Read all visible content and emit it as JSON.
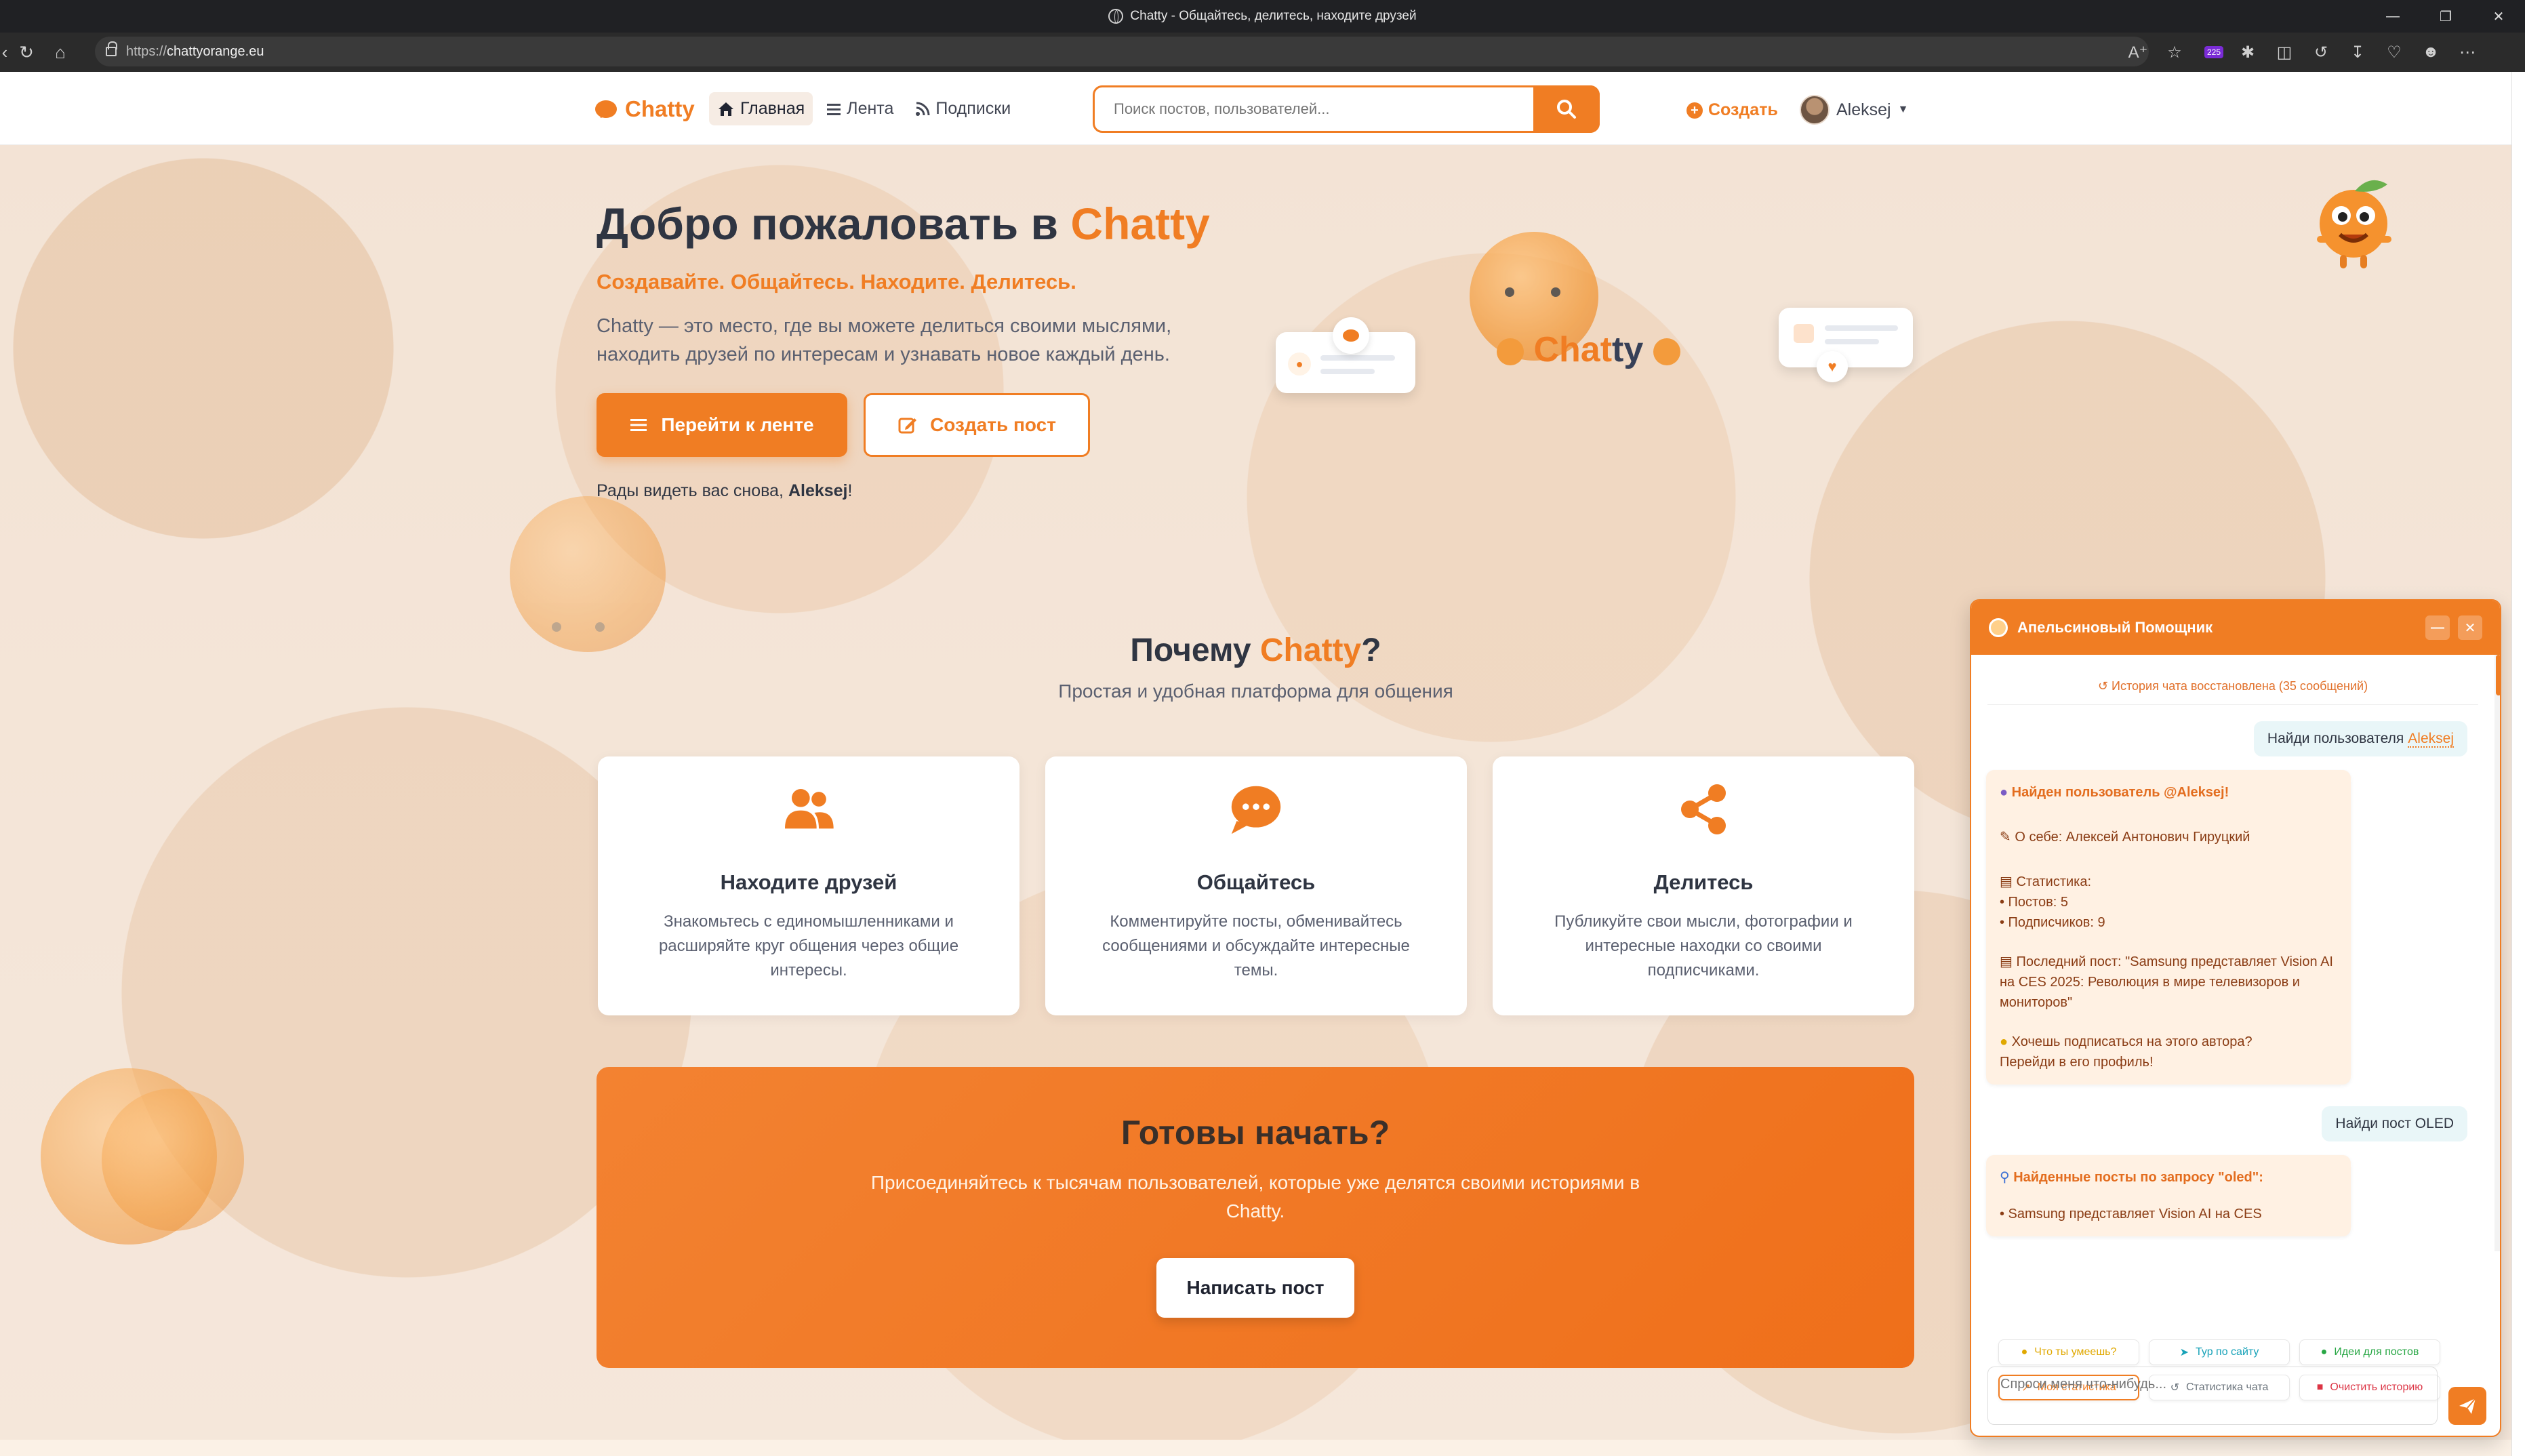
{
  "browser": {
    "window_title": "Chatty - Общайтесь, делитесь, находите друзей",
    "url_prefix": "https://",
    "url_host": "chattyorange.eu",
    "ext_badge": "225"
  },
  "nav": {
    "logo": "Chatty",
    "links": [
      {
        "label": "Главная",
        "active": true
      },
      {
        "label": "Лента"
      },
      {
        "label": "Подписки"
      }
    ],
    "search_placeholder": "Поиск постов, пользователей...",
    "create_label": "Создать",
    "user_name": "Aleksej"
  },
  "hero": {
    "title_prefix": "Добро пожаловать в ",
    "title_brand": "Chatty",
    "subtitle": "Создавайте. Общайтесь. Находите. Делитесь.",
    "description": "Chatty — это место, где вы можете делиться своими мыслями, находить друзей по интересам и узнавать новое каждый день.",
    "btn_feed": "Перейти к ленте",
    "btn_create": "Создать пост",
    "welcome_prefix": "Рады видеть вас снова, ",
    "welcome_name": "Aleksej",
    "welcome_suffix": "!",
    "illustration_word_a": "Chat",
    "illustration_word_b": "ty"
  },
  "why": {
    "title_prefix": "Почему ",
    "title_brand": "Chatty",
    "title_suffix": "?",
    "subtitle": "Простая и удобная платформа для общения",
    "features": [
      {
        "title": "Находите друзей",
        "text": "Знакомьтесь с единомышленниками и расширяйте круг общения через общие интересы."
      },
      {
        "title": "Общайтесь",
        "text": "Комментируйте посты, обменивайтесь сообщениями и обсуждайте интересные темы."
      },
      {
        "title": "Делитесь",
        "text": "Публикуйте свои мысли, фотографии и интересные находки со своими подписчиками."
      }
    ]
  },
  "cta": {
    "title": "Готовы начать?",
    "text": "Присоединяйтесь к тысячам пользователей, которые уже делятся своими историями в Chatty.",
    "button": "Написать пост"
  },
  "chat": {
    "title": "Апельсиновый Помощник",
    "restored": "История чата восстановлена (35 сообщений)",
    "user_msg_1_text": "Найди пользователя",
    "user_msg_1_mention": "Aleksej",
    "bot_1": {
      "found": "Найден пользователь @Aleksej!",
      "about": "О себе: Алексей Антонович Гируцкий",
      "stats_title": "Статистика:",
      "stat_posts": "• Постов: 5",
      "stat_subs": "• Подписчиков: 9",
      "last_post": "Последний пост: \"Samsung представляет Vision AI на CES 2025: Революция в мире телевизоров и мониторов\"",
      "suggest": "Хочешь подписаться на этого автора?",
      "suggest_link": "Перейди в его профиль!"
    },
    "user_msg_2": "Найди пост OLED",
    "bot_2": {
      "found": "Найденные посты по запросу \"oled\":",
      "preview": "• Samsung представляет Vision AI на CES"
    },
    "chips": [
      {
        "label": "Что ты умеешь?",
        "color": "#e0a800"
      },
      {
        "label": "Тур по сайту",
        "color": "#17a2b8"
      },
      {
        "label": "Идеи для постов",
        "color": "#28a745"
      },
      {
        "label": "Моя статистика",
        "color": "#f07d23"
      },
      {
        "label": "Статистика чата",
        "color": "#6c757d"
      },
      {
        "label": "Очистить историю",
        "color": "#dc3545"
      }
    ],
    "input_placeholder": "Спроси меня что-нибудь..."
  },
  "colors": {
    "accent": "#f07d23",
    "dark_text": "#2f3542"
  }
}
